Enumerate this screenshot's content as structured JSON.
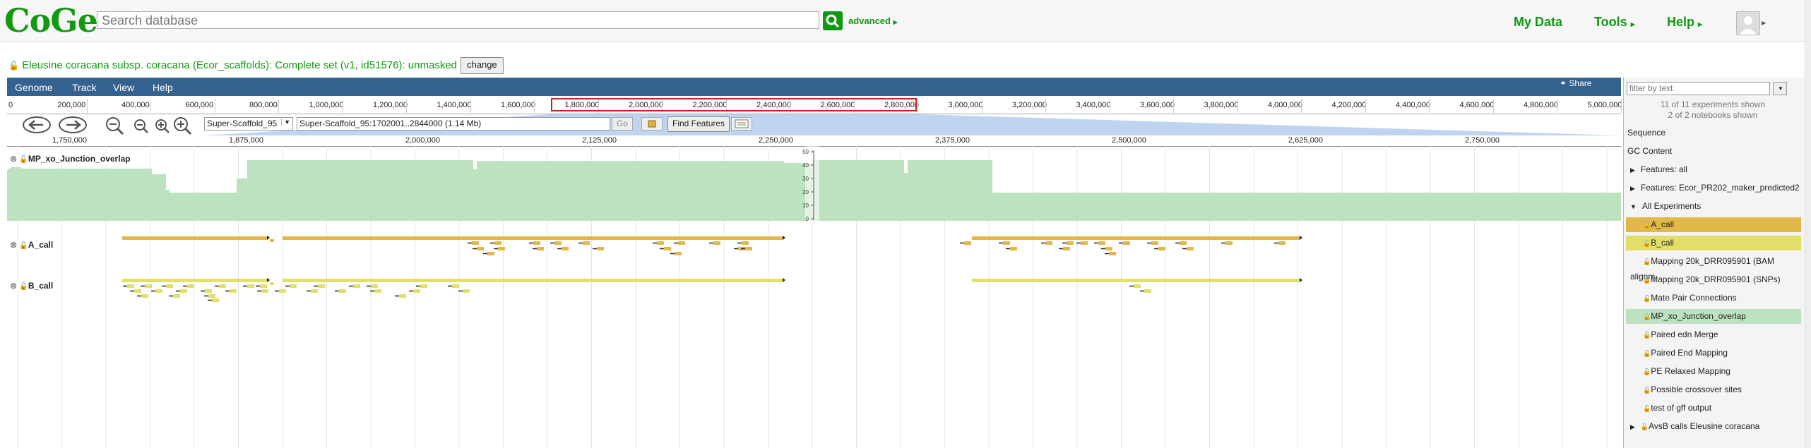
{
  "header": {
    "logo": "CoGe",
    "search_placeholder": "Search database",
    "advanced": "advanced",
    "nav": [
      "My Data",
      "Tools",
      "Help"
    ]
  },
  "genome": {
    "title": "Eleusine coracana subsp. coracana (Ecor_scaffolds): Complete set (v1, id51576): unmasked",
    "change_label": "change"
  },
  "browser": {
    "menu": [
      "Genome",
      "Track",
      "View",
      "Help"
    ],
    "share": "Share",
    "overview_ticks": [
      "0",
      "200,000",
      "400,000",
      "600,000",
      "800,000",
      "1,000,000",
      "1,200,000",
      "1,400,000",
      "1,600,000",
      "1,800,000",
      "2,000,000",
      "2,200,000",
      "2,400,000",
      "2,600,000",
      "2,800,000",
      "3,000,000",
      "3,200,000",
      "3,400,000",
      "3,600,000",
      "3,800,000",
      "4,000,000",
      "4,200,000",
      "4,400,000",
      "4,600,000",
      "4,800,000",
      "5,000,000"
    ],
    "ref_seq": "Super-Scaffold_95",
    "location": "Super-Scaffold_95:1702001..2844000 (1.14 Mb)",
    "go_label": "Go",
    "find_label": "Find Features",
    "ruler_ticks": [
      "1,750,000",
      "1,875,000",
      "2,000,000",
      "2,125,000",
      "2,250,000",
      "2,375,000",
      "2,500,000",
      "2,625,000",
      "2,750,000"
    ],
    "tracks": [
      "MP_xo_Junction_overlap",
      "A_call",
      "B_call"
    ],
    "yaxis": [
      "50",
      "40",
      "30",
      "20",
      "10",
      "0"
    ]
  },
  "panel": {
    "filter_placeholder": "filter by text",
    "count1": "11 of 11 experiments shown",
    "count2": "2 of 2 notebooks shown",
    "items": [
      {
        "label": "Sequence",
        "type": "plain"
      },
      {
        "label": "GC Content",
        "type": "plain"
      },
      {
        "label": "Features: all",
        "type": "collapsed"
      },
      {
        "label": "Features: Ecor_PR202_maker_predicted2",
        "type": "collapsed"
      },
      {
        "label": "All Experiments",
        "type": "expanded"
      },
      {
        "label": "A_call",
        "type": "exp",
        "color": "#e3b84a"
      },
      {
        "label": "B_call",
        "type": "exp",
        "color": "#e2e06a"
      },
      {
        "label": "Mapping 20k_DRR095901 (BAM alignm",
        "type": "exp"
      },
      {
        "label": "Mapping 20k_DRR095901 (SNPs)",
        "type": "exp"
      },
      {
        "label": "Mate Pair Connections",
        "type": "exp"
      },
      {
        "label": "MP_xo_Junction_overlap",
        "type": "exp",
        "color": "#bde2c0"
      },
      {
        "label": "Paired edn Merge",
        "type": "exp"
      },
      {
        "label": "Paired End Mapping",
        "type": "exp"
      },
      {
        "label": "PE Relaxed Mapping",
        "type": "exp"
      },
      {
        "label": "Possible crossover sites",
        "type": "exp"
      },
      {
        "label": "test of gff output",
        "type": "exp"
      },
      {
        "label": "AvsB calls Eleusine coracana",
        "type": "collapsed-lock"
      }
    ]
  },
  "colors": {
    "brand": "#119911",
    "menubar": "#34628f",
    "a_call": "#e3b84a",
    "b_call": "#e2e06a",
    "coverage": "#bde2c0"
  }
}
